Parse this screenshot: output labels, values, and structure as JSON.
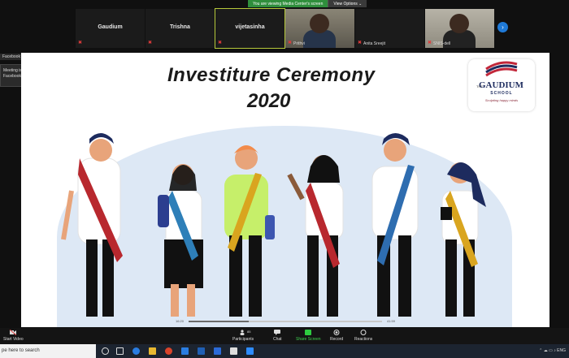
{
  "banner": {
    "message": "You are viewing Media Center's screen",
    "options": "View Options ⌄"
  },
  "participants": [
    {
      "name": "Gaudium",
      "type": "name"
    },
    {
      "name": "Trishna",
      "type": "name"
    },
    {
      "name": "vijetasinha",
      "type": "name",
      "active": true
    },
    {
      "name": "Prithvi",
      "type": "video"
    },
    {
      "name": "Anita Sreejit",
      "type": "name-small"
    },
    {
      "name": "SNIS-dell",
      "type": "video"
    }
  ],
  "toast": {
    "label": "Facebook",
    "text": "Meeting is now streaming live on Facebook"
  },
  "slide": {
    "title_line1": "Investiture Ceremony",
    "title_line2": "2020",
    "logo": {
      "the": "THE",
      "name": "GAUDIUM",
      "school": "SCHOOL",
      "tag": "Sculpting happy minds"
    }
  },
  "player": {
    "current": "16:20",
    "total": "41:59",
    "progress": 0.31
  },
  "toolbar": {
    "start_video": "Start Video",
    "participants": "Participants",
    "participants_count": "85",
    "chat": "Chat",
    "share": "Share Screen",
    "record": "Record",
    "reactions": "Reactions"
  },
  "taskbar": {
    "search_placeholder": "pe here to search",
    "lang": "ENG"
  },
  "colors": {
    "share_green": "#2ecc40",
    "banner_green": "#2f8e3c",
    "slide_bg": "#ffffff",
    "blob": "#dde8f5"
  }
}
